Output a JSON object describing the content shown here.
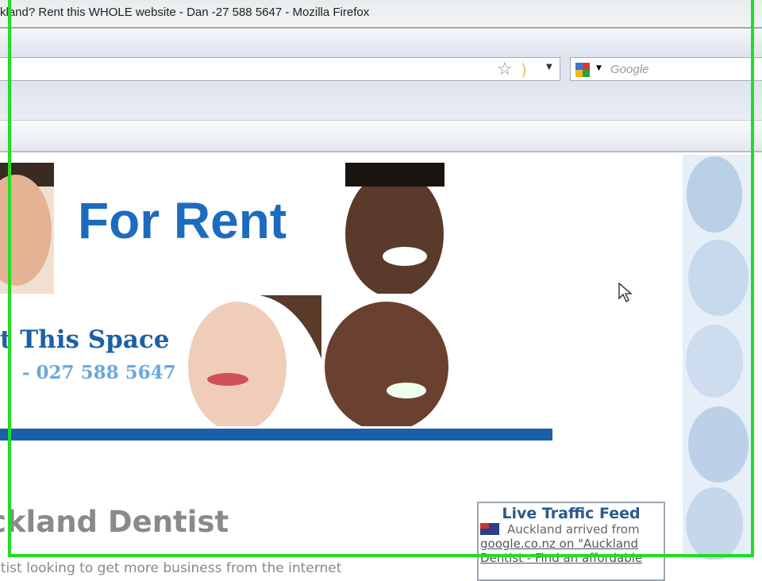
{
  "window": {
    "title": "kland? Rent this WHOLE website - Dan -27 588 5647 - Mozilla Firefox"
  },
  "toolbar": {
    "search_placeholder": "Google",
    "star_icon": "bookmark-star-icon",
    "rss_icon": "feed-icon"
  },
  "banner": {
    "for_rent": "For Rent",
    "this_space": "t This Space",
    "phone": "- 027 588 5647"
  },
  "page": {
    "heading": "ckland Dentist",
    "intro": "ntist looking to get more business from the internet"
  },
  "traffic_feed": {
    "title": "Live Traffic Feed",
    "line1": "Auckland arrived from",
    "line2": "google.co.nz on \"Auckland",
    "line3": "Dentist - Find an affordable"
  },
  "colors": {
    "accent": "#1b5fa8",
    "highlight": "#22dd22"
  }
}
